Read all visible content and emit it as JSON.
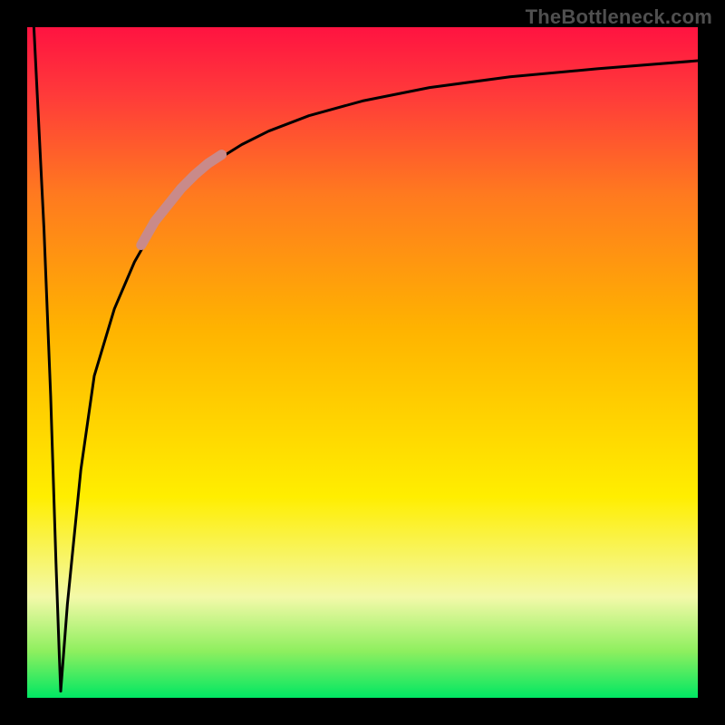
{
  "watermark": "TheBottleneck.com",
  "chart_data": {
    "type": "line",
    "title": "",
    "xlabel": "",
    "ylabel": "",
    "xlim": [
      0,
      100
    ],
    "ylim": [
      0,
      100
    ],
    "grid": false,
    "legend": false,
    "background_gradient_stops": [
      {
        "pos": 0.0,
        "color": "#00e763"
      },
      {
        "pos": 0.07,
        "color": "#8fef5f"
      },
      {
        "pos": 0.15,
        "color": "#f3f9a9"
      },
      {
        "pos": 0.3,
        "color": "#ffee00"
      },
      {
        "pos": 0.55,
        "color": "#ffb300"
      },
      {
        "pos": 0.75,
        "color": "#ff7a1f"
      },
      {
        "pos": 0.9,
        "color": "#ff3a3a"
      },
      {
        "pos": 1.0,
        "color": "#ff1341"
      }
    ],
    "series": [
      {
        "name": "left-drop",
        "stroke": "#000000",
        "width": 3,
        "x": [
          1.0,
          1.5,
          2.5,
          3.5,
          4.3,
          4.8,
          5.0
        ],
        "values": [
          100,
          90,
          70,
          45,
          20,
          6,
          1
        ]
      },
      {
        "name": "rise-curve",
        "stroke": "#000000",
        "width": 3,
        "x": [
          5,
          6,
          8,
          10,
          13,
          16,
          20,
          24,
          28,
          32,
          36,
          42,
          50,
          60,
          72,
          85,
          100
        ],
        "values": [
          1,
          14,
          34,
          48,
          58,
          65,
          72,
          76.5,
          80,
          82.5,
          84.5,
          86.8,
          89,
          91,
          92.6,
          93.8,
          95
        ]
      },
      {
        "name": "highlight-segment",
        "stroke": "#c98a8a",
        "width": 11,
        "x": [
          17,
          19,
          21,
          23,
          25,
          27,
          29
        ],
        "values": [
          67.5,
          71,
          73.5,
          76,
          78,
          79.7,
          81
        ]
      }
    ]
  }
}
